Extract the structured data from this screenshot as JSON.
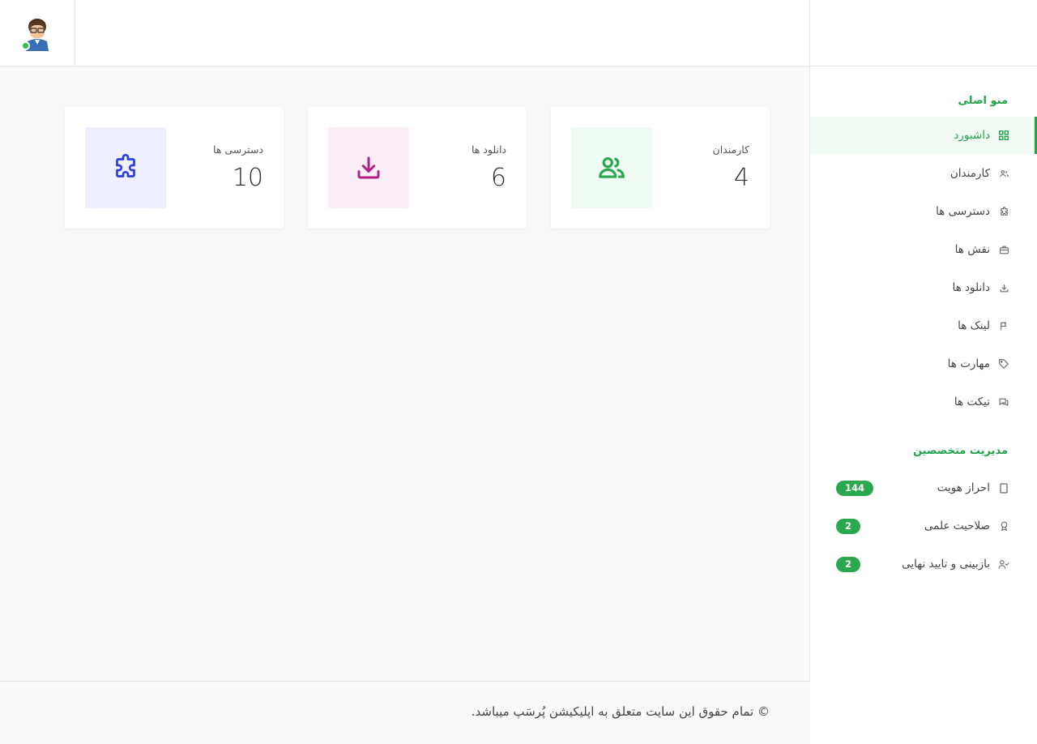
{
  "header": {
    "avatar_alt": "user avatar",
    "online_color": "#2fbf4d"
  },
  "cards": [
    {
      "label": "دسترسی ها",
      "value": "10",
      "icon": "puzzle-icon",
      "color": "#2c3ee0",
      "bg": "#eef0ff"
    },
    {
      "label": "دانلود ها",
      "value": "6",
      "icon": "download-icon",
      "color": "#b21f86",
      "bg": "#fbeff7"
    },
    {
      "label": "کارمندان",
      "value": "4",
      "icon": "users-icon",
      "color": "#2aa84f",
      "bg": "#eefaf2"
    }
  ],
  "sidebar": {
    "main_section_title": "منو اصلی",
    "items": [
      {
        "label": "داشبورد",
        "icon": "dashboard-grid-icon",
        "active": true
      },
      {
        "label": "کارمندان",
        "icon": "users-icon"
      },
      {
        "label": "دسترسی ها",
        "icon": "puzzle-icon"
      },
      {
        "label": "نقش ها",
        "icon": "briefcase-icon"
      },
      {
        "label": "دانلود ها",
        "icon": "download-icon"
      },
      {
        "label": "لینک ها",
        "icon": "flag-icon"
      },
      {
        "label": "مهارت ها",
        "icon": "tag-icon"
      },
      {
        "label": "تیکت ها",
        "icon": "chat-icon"
      }
    ],
    "expert_section_title": "مدیریت متخصصین",
    "expert_items": [
      {
        "label": "احراز هویت",
        "icon": "id-card-icon",
        "badge": "144"
      },
      {
        "label": "صلاحیت علمی",
        "icon": "award-icon",
        "badge": "2"
      },
      {
        "label": "بازبینی و تایید نهایی",
        "icon": "user-check-icon",
        "badge": "2"
      }
    ],
    "accent_color": "#20a34a"
  },
  "footer": {
    "copyright": "© تمام حقوق این سایت متعلق به اپلیکیشن پُرسَپ میباشد."
  }
}
